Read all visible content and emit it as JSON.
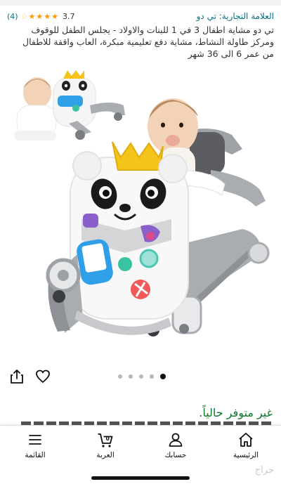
{
  "header": {
    "rating_count": "(4)",
    "rating_value": "3.7",
    "stars_filled": 4,
    "stars_total": 5,
    "brand": "العلامة التجارية: تي دو",
    "title": "تي دو مشاية اطفال 3 في 1 للبنات والاولاد - يجلس الطفل للوقوف ومركز طاولة النشاط، مشاية دفع تعليمية مبكرة، العاب واقفة للاطفال من عمر 6 الى 36 شهر"
  },
  "gallery": {
    "dot_count": 5,
    "active_dot": 4
  },
  "availability": "غير متوفر حالياً.",
  "bottom_nav": {
    "home": "الرئيسية",
    "account": "حسابك",
    "cart": "العربة",
    "cart_count": "0",
    "menu": "القائمة"
  },
  "watermark": "حراج",
  "colors": {
    "link": "#007185",
    "star": "#ff9900",
    "availability": "#0b7a2a",
    "walker_grey": "#a9acb0",
    "crown": "#f4c41a"
  }
}
